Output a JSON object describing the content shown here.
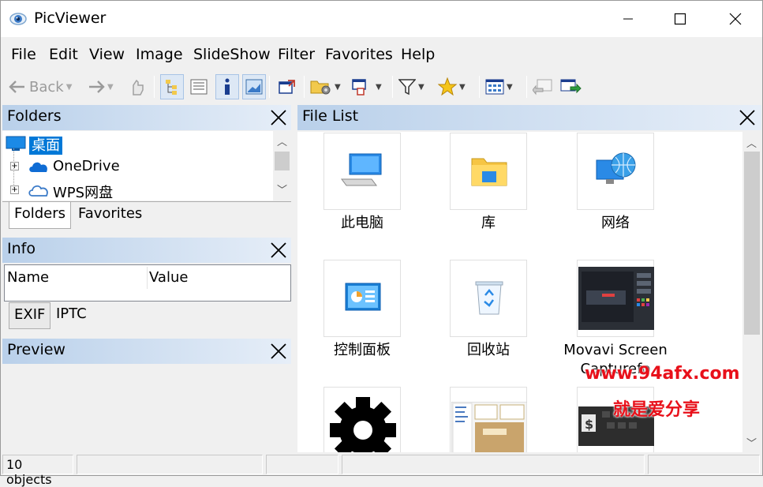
{
  "window": {
    "title": "PicViewer"
  },
  "menu": [
    "File",
    "Edit",
    "View",
    "Image",
    "SlideShow",
    "Filter",
    "Favorites",
    "Help"
  ],
  "toolbar": {
    "back_label": "Back"
  },
  "folders": {
    "title": "Folders",
    "tree": [
      {
        "label": "桌面",
        "icon": "desktop-icon",
        "selected": true
      },
      {
        "label": "OneDrive",
        "icon": "onedrive-cloud-icon"
      },
      {
        "label": "WPS网盘",
        "icon": "wps-cloud-icon"
      }
    ],
    "tabs": [
      "Folders",
      "Favorites"
    ]
  },
  "info": {
    "title": "Info",
    "columns": [
      "Name",
      "Value"
    ],
    "tabs": [
      "EXIF",
      "IPTC"
    ]
  },
  "preview": {
    "title": "Preview"
  },
  "filelist": {
    "title": "File List",
    "items": [
      {
        "label": "此电脑",
        "icon": "computer-icon"
      },
      {
        "label": "库",
        "icon": "library-folder-icon"
      },
      {
        "label": "网络",
        "icon": "network-globe-icon"
      },
      {
        "label": "控制面板",
        "icon": "control-panel-icon"
      },
      {
        "label": "回收站",
        "icon": "recycle-bin-icon"
      },
      {
        "label": "Movavi Screen Capturefo",
        "icon": "movavi-thumbnail"
      },
      {
        "label": "",
        "icon": "gear-icon"
      },
      {
        "label": "",
        "icon": "screenshot-thumbnail"
      },
      {
        "label": "",
        "icon": "dark-thumbnail"
      }
    ]
  },
  "watermark": {
    "line1": "www.94afx.com",
    "line2": "就是爱分享"
  },
  "status": {
    "count": "10 objects"
  }
}
